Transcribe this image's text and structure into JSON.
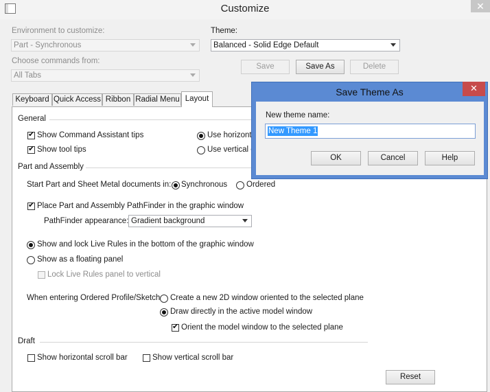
{
  "window": {
    "title": "Customize",
    "close_symbol": "✕"
  },
  "env": {
    "label": "Environment to customize:",
    "value": "Part - Synchronous"
  },
  "choose": {
    "label": "Choose commands from:",
    "value": "All Tabs"
  },
  "theme": {
    "label": "Theme:",
    "value": "Balanced - Solid Edge Default",
    "save": "Save",
    "save_as": "Save As",
    "delete": "Delete"
  },
  "tabs": [
    "Keyboard",
    "Quick Access",
    "Ribbon",
    "Radial Menu",
    "Layout"
  ],
  "general": {
    "title": "General",
    "show_cmd_assist": "Show Command Assistant tips",
    "show_tool_tips": "Show tool tips",
    "use_horizontal": "Use horizonta",
    "use_vertical": "Use vertical c"
  },
  "part": {
    "title": "Part and Assembly",
    "start_label": "Start Part and Sheet Metal documents in:",
    "synchronous": "Synchronous",
    "ordered": "Ordered",
    "pathfinder": "Place Part and Assembly PathFinder in the graphic window",
    "appearance_label": "PathFinder appearance:",
    "appearance_value": "Gradient background",
    "live_rules_lock": "Show and lock Live Rules in the bottom of the graphic window",
    "floating": "Show as a floating panel",
    "lock_vertical": "Lock Live Rules panel to vertical",
    "entering_label": "When entering Ordered Profile/Sketch",
    "new_window": "Create a new 2D window oriented to the selected plane",
    "draw_directly": "Draw directly in the active model window",
    "orient": "Orient the model window to the selected plane"
  },
  "draft": {
    "title": "Draft",
    "hscroll": "Show horizontal scroll bar",
    "vscroll": "Show vertical scroll bar"
  },
  "reset": "Reset",
  "dialog": {
    "title": "Save Theme As",
    "close_symbol": "✕",
    "name_label": "New theme name:",
    "name_value": "New Theme 1",
    "ok": "OK",
    "cancel": "Cancel",
    "help": "Help"
  }
}
